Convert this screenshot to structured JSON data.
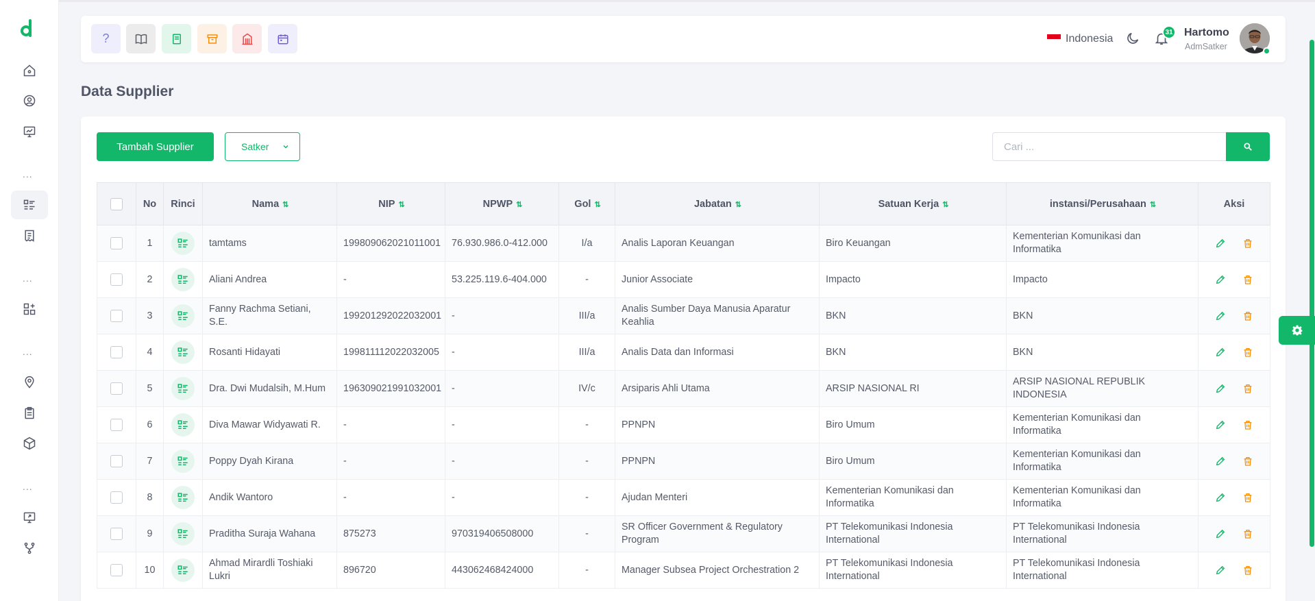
{
  "colors": {
    "accent": "#12b76a",
    "danger": "#e3001b",
    "warning": "#f79009"
  },
  "sidebar": {
    "logo": "d",
    "icons": [
      "home-icon",
      "user-circle-icon",
      "chart-monitor-icon",
      "list-icon",
      "receipt-icon",
      "grid-plus-icon",
      "map-pin-icon",
      "clipboard-icon",
      "cube-icon",
      "screen-share-icon",
      "branch-icon"
    ],
    "dots": "..."
  },
  "header": {
    "quick_buttons": [
      "help-icon",
      "book-icon",
      "notebook-icon",
      "archive-icon",
      "building-icon",
      "calendar-icon"
    ],
    "help_label": "?",
    "language": "Indonesia",
    "notification_count": "31",
    "user": {
      "name": "Hartomo",
      "role": "AdmSatker"
    }
  },
  "page": {
    "title": "Data Supplier"
  },
  "toolbar": {
    "add_label": "Tambah Supplier",
    "satker_label": "Satker",
    "search_placeholder": "Cari ..."
  },
  "table": {
    "columns": [
      "No",
      "Rinci",
      "Nama",
      "NIP",
      "NPWP",
      "Gol",
      "Jabatan",
      "Satuan Kerja",
      "instansi/Perusahaan",
      "Aksi"
    ],
    "sortable": [
      "Nama",
      "NIP",
      "NPWP",
      "Gol",
      "Jabatan",
      "Satuan Kerja",
      "instansi/Perusahaan"
    ],
    "sort_glyph": "⇅",
    "rows": [
      {
        "no": "1",
        "nama": "tamtams",
        "nip": "199809062021011001",
        "npwp": "76.930.986.0-412.000",
        "gol": "I/a",
        "jabatan": "Analis Laporan Keuangan",
        "satker": "Biro Keuangan",
        "instansi": "Kementerian Komunikasi dan Informatika"
      },
      {
        "no": "2",
        "nama": "Aliani Andrea",
        "nip": "-",
        "npwp": "53.225.119.6-404.000",
        "gol": "-",
        "jabatan": "Junior Associate",
        "satker": "Impacto",
        "instansi": "Impacto"
      },
      {
        "no": "3",
        "nama": "Fanny Rachma Setiani, S.E.",
        "nip": "199201292022032001",
        "npwp": "-",
        "gol": "III/a",
        "jabatan": "Analis Sumber Daya Manusia Aparatur Keahlia",
        "satker": "BKN",
        "instansi": "BKN"
      },
      {
        "no": "4",
        "nama": "Rosanti Hidayati",
        "nip": "199811112022032005",
        "npwp": "-",
        "gol": "III/a",
        "jabatan": "Analis Data dan Informasi",
        "satker": "BKN",
        "instansi": "BKN"
      },
      {
        "no": "5",
        "nama": "Dra. Dwi Mudalsih, M.Hum",
        "nip": "196309021991032001",
        "npwp": "-",
        "gol": "IV/c",
        "jabatan": "Arsiparis Ahli Utama",
        "satker": "ARSIP NASIONAL RI",
        "instansi": "ARSIP NASIONAL REPUBLIK INDONESIA"
      },
      {
        "no": "6",
        "nama": "Diva Mawar Widyawati R.",
        "nip": "-",
        "npwp": "-",
        "gol": "-",
        "jabatan": "PPNPN",
        "satker": "Biro Umum",
        "instansi": "Kementerian Komunikasi dan Informatika"
      },
      {
        "no": "7",
        "nama": "Poppy Dyah Kirana",
        "nip": "-",
        "npwp": "-",
        "gol": "-",
        "jabatan": "PPNPN",
        "satker": "Biro Umum",
        "instansi": "Kementerian Komunikasi dan Informatika"
      },
      {
        "no": "8",
        "nama": "Andik Wantoro",
        "nip": "-",
        "npwp": "-",
        "gol": "-",
        "jabatan": "Ajudan Menteri",
        "satker": "Kementerian Komunikasi dan Informatika",
        "instansi": "Kementerian Komunikasi dan Informatika"
      },
      {
        "no": "9",
        "nama": "Praditha Suraja Wahana",
        "nip": "875273",
        "npwp": "970319406508000",
        "gol": "-",
        "jabatan": "SR Officer Government & Regulatory Program",
        "satker": "PT Telekomunikasi Indonesia International",
        "instansi": "PT Telekomunikasi Indonesia International"
      },
      {
        "no": "10",
        "nama": "Ahmad Mirardli Toshiaki Lukri",
        "nip": "896720",
        "npwp": "443062468424000",
        "gol": "-",
        "jabatan": "Manager Subsea Project Orchestration 2",
        "satker": "PT Telekomunikasi Indonesia International",
        "instansi": "PT Telekomunikasi Indonesia International"
      }
    ]
  }
}
